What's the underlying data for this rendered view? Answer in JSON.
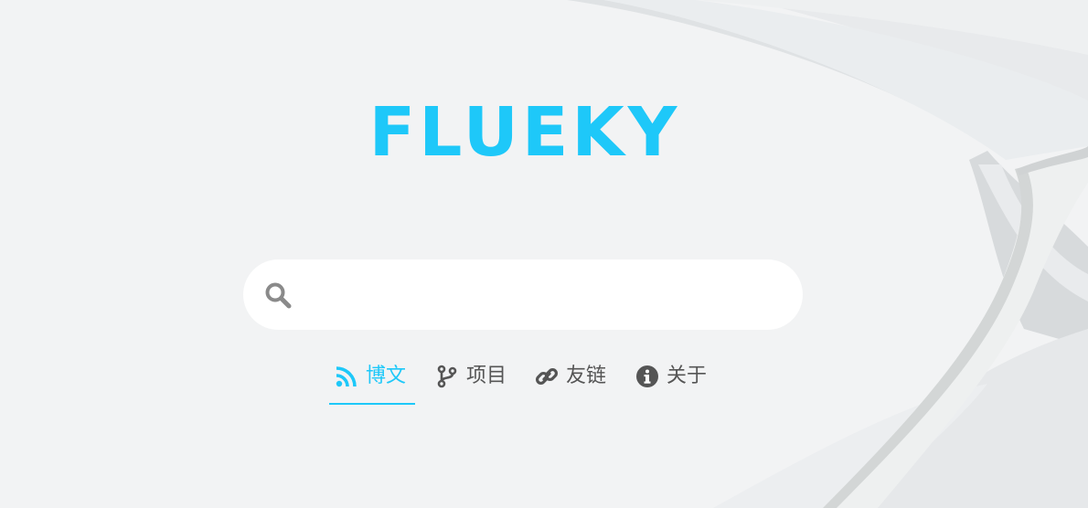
{
  "brand": {
    "title": "FLUEKY",
    "color": "#1ec8f9"
  },
  "search": {
    "value": "",
    "placeholder": "",
    "icon": "search-icon"
  },
  "nav": {
    "accent": "#1ec8f9",
    "text_color": "#555555",
    "items": [
      {
        "label": "博文",
        "icon": "rss-icon",
        "active": true
      },
      {
        "label": "项目",
        "icon": "code-branch-icon",
        "active": false
      },
      {
        "label": "友链",
        "icon": "link-icon",
        "active": false
      },
      {
        "label": "关于",
        "icon": "info-circle-icon",
        "active": false
      }
    ]
  }
}
